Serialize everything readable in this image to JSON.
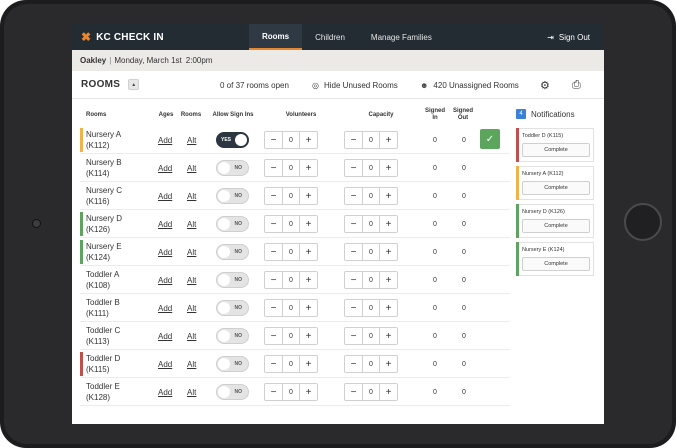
{
  "app": {
    "logo_mark": "✖",
    "logo_text": "KC CHECK IN"
  },
  "nav": {
    "tabs": [
      {
        "label": "Rooms",
        "active": true
      },
      {
        "label": "Children",
        "active": false
      },
      {
        "label": "Manage Families",
        "active": false
      }
    ],
    "sign_out": "Sign Out"
  },
  "location": {
    "name": "Oakley",
    "separator": "|",
    "date": "Monday, March 1st",
    "time": "2:00pm"
  },
  "rooms_header": {
    "title": "ROOMS",
    "caret": "▲",
    "open_status": "0 of 37 rooms open",
    "hide_unused": "Hide Unused Rooms",
    "unassigned": "420 Unassigned Rooms"
  },
  "table": {
    "columns": {
      "rooms": "Rooms",
      "ages": "Ages",
      "rooms_col": "Rooms",
      "allow": "Allow Sign Ins",
      "volunteers": "Volunteers",
      "capacity": "Capacity",
      "signed_in": "Signed\nIn",
      "signed_out": "Signed\nOut"
    },
    "rows": [
      {
        "name": "Nursery A",
        "code": "(K112)",
        "ages": "Add",
        "rooms": "Alt",
        "allow": "YES",
        "on": true,
        "volunteers": "0",
        "capacity": "0",
        "signed_in": "0",
        "signed_out": "0",
        "tag_color": "#f0b34a",
        "confirm": true
      },
      {
        "name": "Nursery B",
        "code": "(K114)",
        "ages": "Add",
        "rooms": "Alt",
        "allow": "NO",
        "on": false,
        "volunteers": "0",
        "capacity": "0",
        "signed_in": "0",
        "signed_out": "0",
        "tag_color": "",
        "confirm": false
      },
      {
        "name": "Nursery C",
        "code": "(K116)",
        "ages": "Add",
        "rooms": "Alt",
        "allow": "NO",
        "on": false,
        "volunteers": "0",
        "capacity": "0",
        "signed_in": "0",
        "signed_out": "0",
        "tag_color": "",
        "confirm": false
      },
      {
        "name": "Nursery D",
        "code": "(K126)",
        "ages": "Add",
        "rooms": "Alt",
        "allow": "NO",
        "on": false,
        "volunteers": "0",
        "capacity": "0",
        "signed_in": "0",
        "signed_out": "0",
        "tag_color": "#5ea35f",
        "confirm": false
      },
      {
        "name": "Nursery E",
        "code": "(K124)",
        "ages": "Add",
        "rooms": "Alt",
        "allow": "NO",
        "on": false,
        "volunteers": "0",
        "capacity": "0",
        "signed_in": "0",
        "signed_out": "0",
        "tag_color": "#5ea35f",
        "confirm": false
      },
      {
        "name": "Toddler A",
        "code": "(K108)",
        "ages": "Add",
        "rooms": "Alt",
        "allow": "NO",
        "on": false,
        "volunteers": "0",
        "capacity": "0",
        "signed_in": "0",
        "signed_out": "0",
        "tag_color": "",
        "confirm": false
      },
      {
        "name": "Toddler B",
        "code": "(K111)",
        "ages": "Add",
        "rooms": "Alt",
        "allow": "NO",
        "on": false,
        "volunteers": "0",
        "capacity": "0",
        "signed_in": "0",
        "signed_out": "0",
        "tag_color": "",
        "confirm": false
      },
      {
        "name": "Toddler C",
        "code": "(K113)",
        "ages": "Add",
        "rooms": "Alt",
        "allow": "NO",
        "on": false,
        "volunteers": "0",
        "capacity": "0",
        "signed_in": "0",
        "signed_out": "0",
        "tag_color": "",
        "confirm": false
      },
      {
        "name": "Toddler D",
        "code": "(K115)",
        "ages": "Add",
        "rooms": "Alt",
        "allow": "NO",
        "on": false,
        "volunteers": "0",
        "capacity": "0",
        "signed_in": "0",
        "signed_out": "0",
        "tag_color": "#c0504d",
        "confirm": false
      },
      {
        "name": "Toddler E",
        "code": "(K128)",
        "ages": "Add",
        "rooms": "Alt",
        "allow": "NO",
        "on": false,
        "volunteers": "0",
        "capacity": "0",
        "signed_in": "0",
        "signed_out": "0",
        "tag_color": "",
        "confirm": false
      }
    ],
    "minus": "−",
    "plus": "+",
    "check": "✓"
  },
  "notifications": {
    "title": "Notifications",
    "count": "4",
    "items": [
      {
        "label": "Toddler D (K115)",
        "action": "Complete",
        "color": "#c0504d"
      },
      {
        "label": "Nursery A (K112)",
        "action": "Complete",
        "color": "#f0b34a"
      },
      {
        "label": "Nursery D (K126)",
        "action": "Complete",
        "color": "#5ea35f"
      },
      {
        "label": "Nursery E (K124)",
        "action": "Complete",
        "color": "#5ea35f"
      }
    ]
  },
  "icons": {
    "sign_out": "⇥",
    "hide": "◎",
    "people": "☻",
    "settings": "⚙",
    "print": "⎙"
  }
}
